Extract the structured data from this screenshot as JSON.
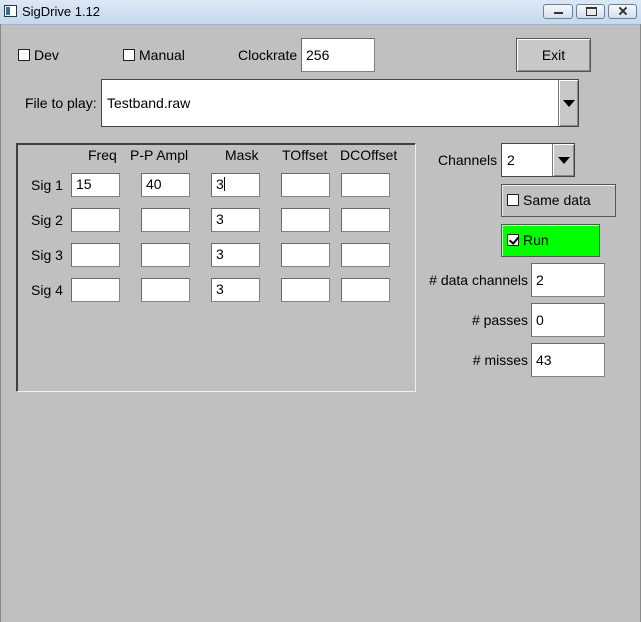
{
  "window": {
    "title": "SigDrive 1.12",
    "controls": [
      "minimize",
      "maximize",
      "close"
    ]
  },
  "top": {
    "dev_label": "Dev",
    "dev_checked": false,
    "manual_label": "Manual",
    "manual_checked": false,
    "clockrate_label": "Clockrate",
    "clockrate_value": "256",
    "exit_label": "Exit"
  },
  "file": {
    "label": "File to play:",
    "value": "Testband.raw"
  },
  "signals": {
    "columns": [
      "Freq",
      "P-P Ampl",
      "Mask",
      "TOffset",
      "DCOffset"
    ],
    "rows": [
      {
        "label": "Sig 1",
        "freq": "15",
        "ampl": "40",
        "mask": "3",
        "toffset": "",
        "dcoffset": ""
      },
      {
        "label": "Sig 2",
        "freq": "",
        "ampl": "",
        "mask": "3",
        "toffset": "",
        "dcoffset": ""
      },
      {
        "label": "Sig 3",
        "freq": "",
        "ampl": "",
        "mask": "3",
        "toffset": "",
        "dcoffset": ""
      },
      {
        "label": "Sig 4",
        "freq": "",
        "ampl": "",
        "mask": "3",
        "toffset": "",
        "dcoffset": ""
      }
    ]
  },
  "side": {
    "channels_label": "Channels",
    "channels_value": "2",
    "same_data_label": "Same data",
    "same_data_checked": false,
    "run_label": "Run",
    "run_checked": true,
    "run_color": "#00ff00",
    "data_channels_label": "# data channels",
    "data_channels_value": "2",
    "passes_label": "# passes",
    "passes_value": "0",
    "misses_label": "# misses",
    "misses_value": "43"
  }
}
